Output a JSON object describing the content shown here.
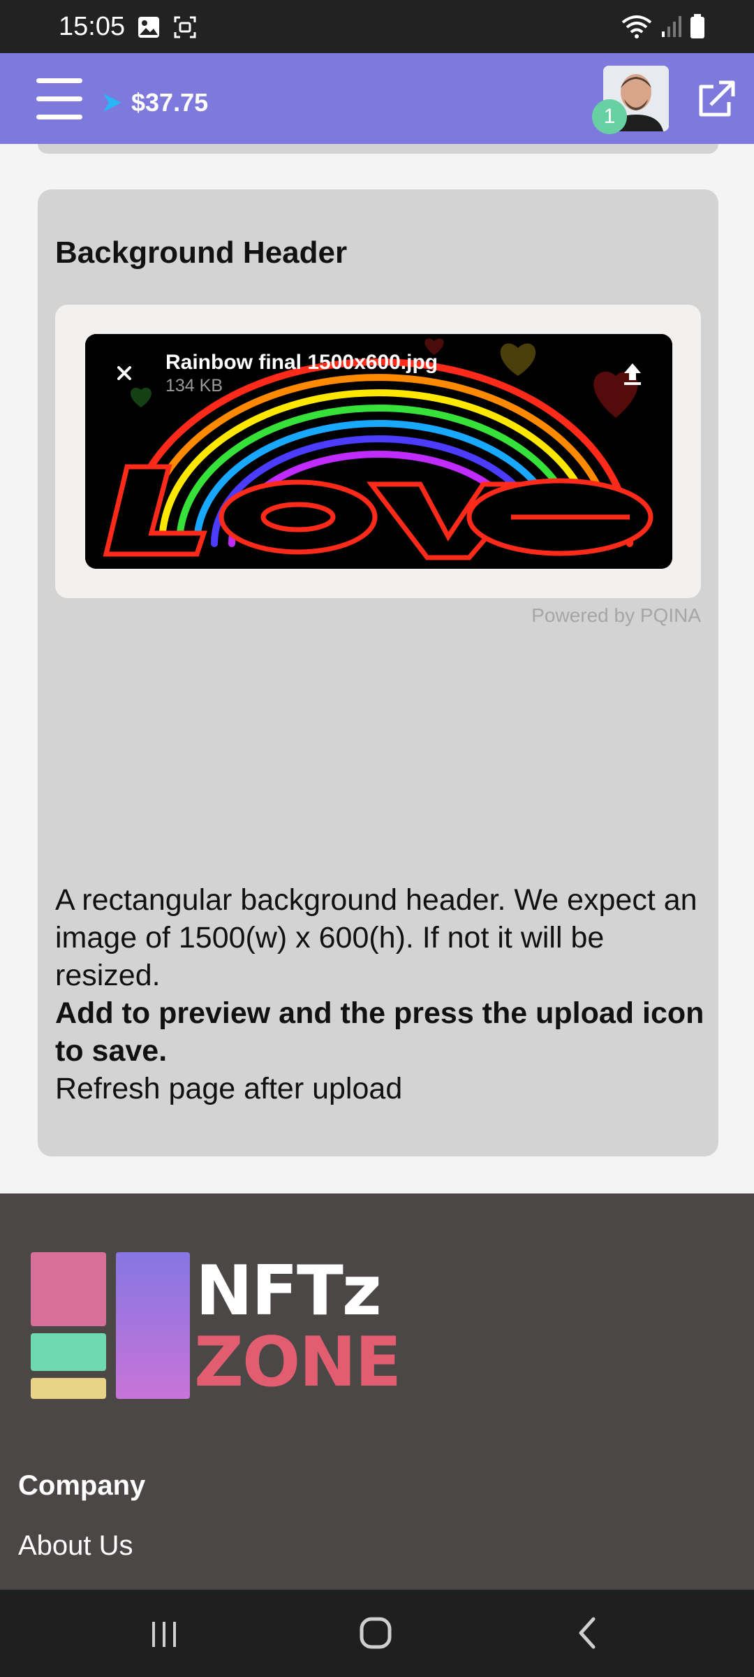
{
  "status_bar": {
    "time": "15:05"
  },
  "header": {
    "balance": "$37.75",
    "notification_count": "1"
  },
  "card": {
    "title": "Background Header",
    "uploader": {
      "file_name": "Rainbow final 1500x600.jpg",
      "file_size": "134 KB",
      "powered_by": "Powered by PQINA"
    },
    "description": {
      "line1": "A rectangular background header. We expect an image of 1500(w) x 600(h). If not it will be resized.",
      "line2": "Add to preview and the press the upload icon to save.",
      "line3": "Refresh page after upload"
    }
  },
  "footer": {
    "logo_text_top": "NFTz",
    "logo_text_bottom": "ZONE",
    "section_heading": "Company",
    "links": [
      "About Us"
    ]
  },
  "colors": {
    "header_bg": "#7e79dc",
    "card_bg": "#d3d3d3",
    "footer_bg": "#4c4747",
    "badge": "#67d1a4",
    "logo_pink": "#d77098",
    "logo_green": "#6fd9b1",
    "logo_yellow": "#e9d386",
    "logo_purple_top": "#8676e3",
    "logo_purple_bottom": "#c874d8",
    "logo_zone": "#e35d70"
  },
  "icons": {
    "status": [
      "gallery-icon",
      "screenshot-icon",
      "wifi-icon",
      "signal-icon",
      "battery-icon"
    ],
    "header": [
      "menu-icon",
      "balance-arrow-icon",
      "external-link-icon"
    ],
    "uploader": [
      "close-icon",
      "upload-icon"
    ],
    "nav": [
      "recents-icon",
      "home-icon",
      "back-icon"
    ]
  }
}
